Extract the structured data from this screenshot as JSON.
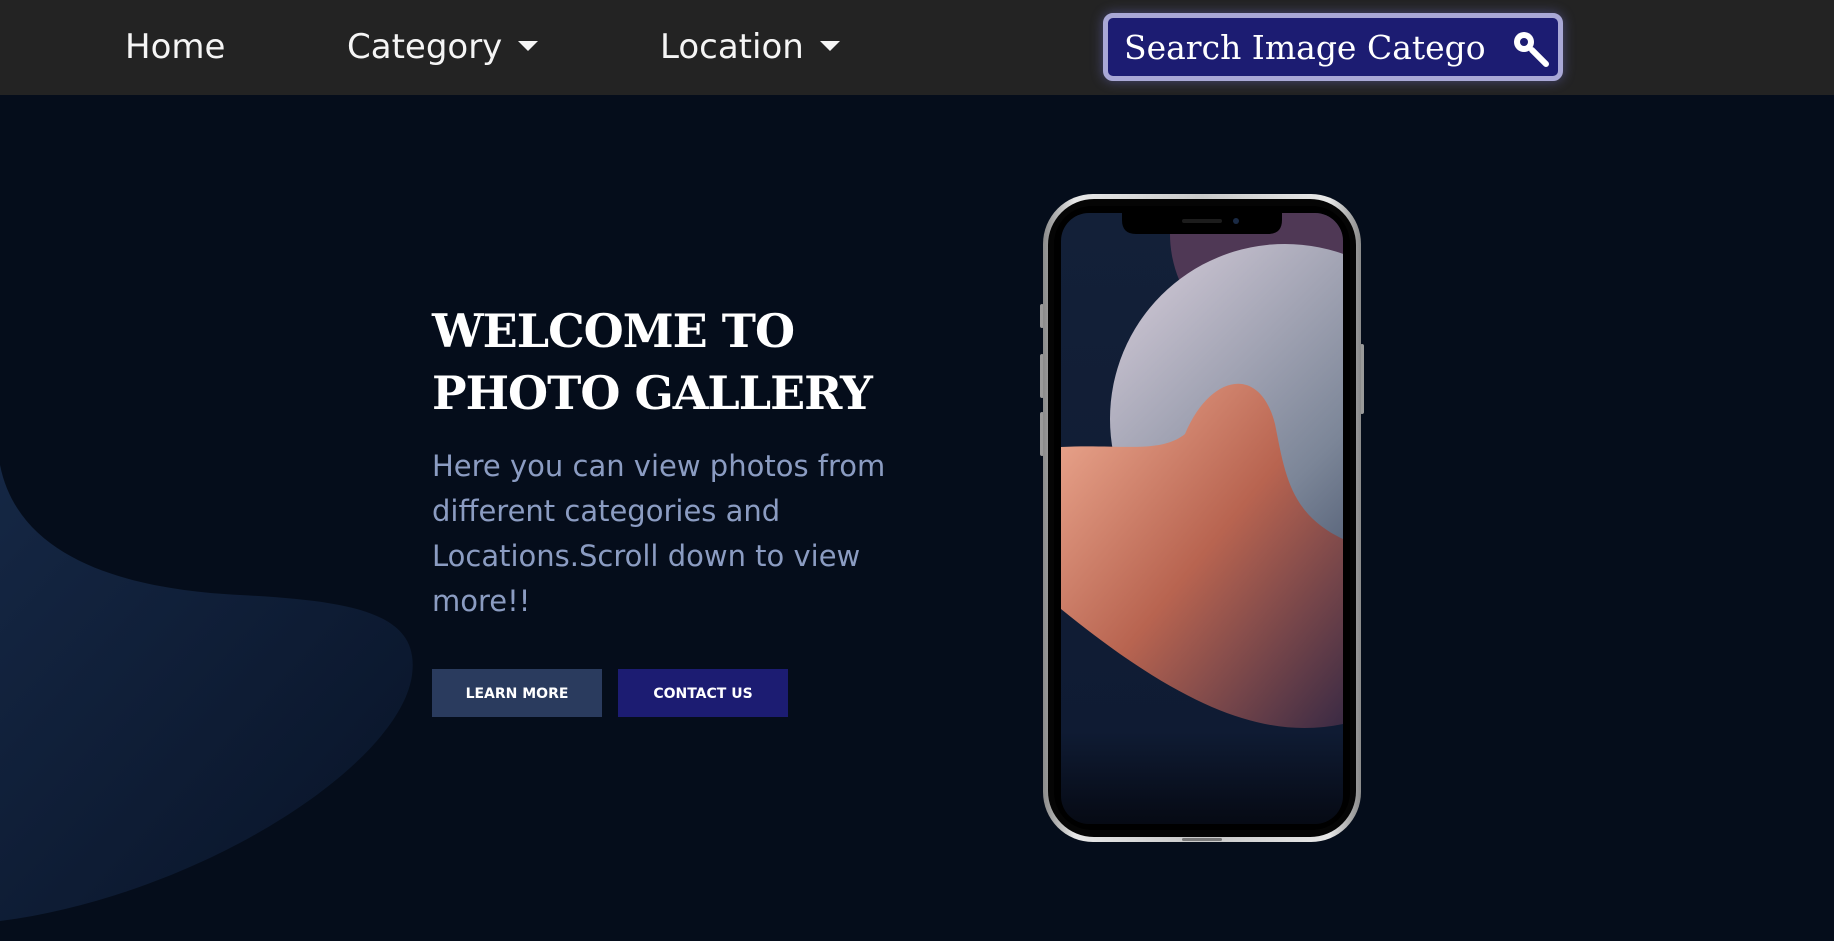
{
  "nav": {
    "home": "Home",
    "category": "Category",
    "location": "Location"
  },
  "search": {
    "placeholder": "Search Image Category"
  },
  "hero": {
    "title_line1": "WELCOME TO",
    "title_line2": "PHOTO GALLERY",
    "description": "Here you can view photos from different categories and Locations.Scroll down to view more!!",
    "learn_more": "LEARN MORE",
    "contact_us": "CONTACT US"
  },
  "icons": {
    "search": "search-icon",
    "caret": "caret-down-icon"
  },
  "colors": {
    "navbar": "#232323",
    "background": "#050d1b",
    "search_bg": "#1c1c72",
    "learn_more_bg": "#2a3b5e",
    "contact_us_bg": "#1c1c72",
    "description_text": "#8b9cc2"
  }
}
